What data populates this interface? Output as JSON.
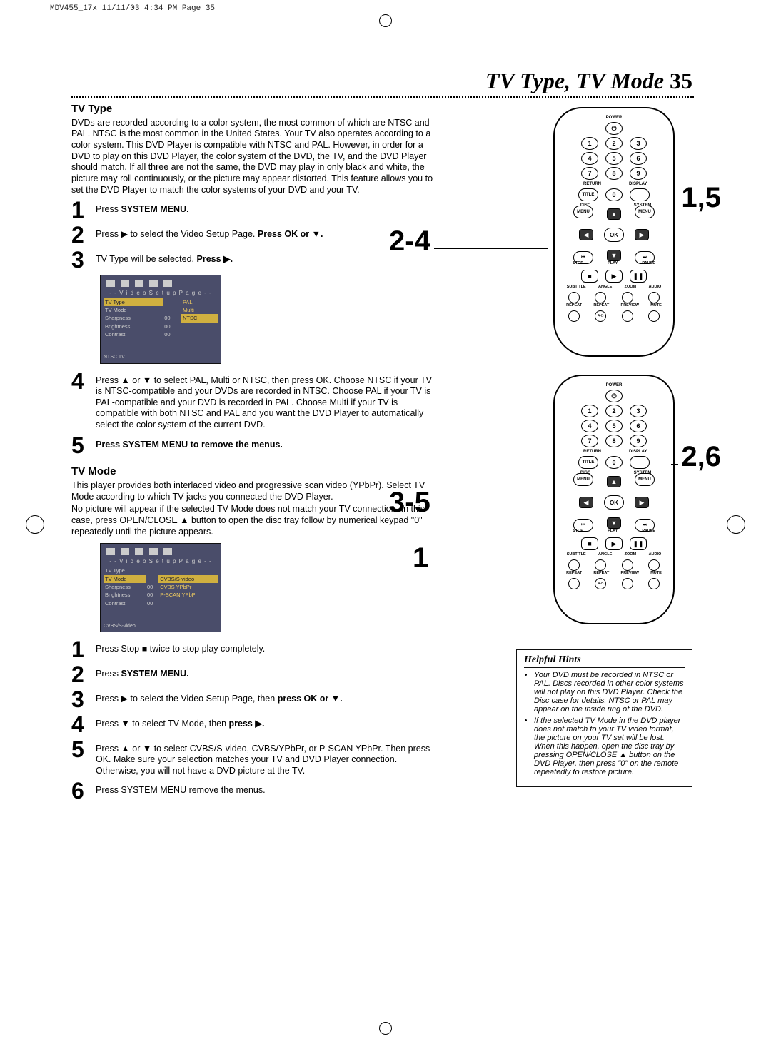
{
  "print_header": "MDV455_17x  11/11/03  4:34 PM  Page 35",
  "page_title": "TV Type, TV Mode",
  "page_number": "35",
  "tv_type": {
    "heading": "TV Type",
    "intro": "DVDs are recorded according to a color system, the most common of which are NTSC and PAL. NTSC is the most common in the United States. Your TV also operates according to a color system. This DVD Player is compatible with NTSC and PAL. However, in order for a DVD to play on this DVD Player, the color system of the DVD, the TV, and the DVD Player should match. If all three are not the same, the DVD may play in only black and white, the picture may roll continuously,  or the picture may appear distorted. This feature allows you to set the DVD Player to match the color systems of your DVD and your TV.",
    "step1_a": "Press ",
    "step1_b": "SYSTEM MENU.",
    "step2_a": "Press ▶ to select the Video Setup Page.  ",
    "step2_b": "Press OK or ▼.",
    "step3_a": "TV Type will be selected. ",
    "step3_b": "Press ▶.",
    "step4": "Press ▲ or ▼ to select PAL, Multi or NTSC, then press OK. Choose NTSC if your TV is NTSC-compatible and your DVDs are recorded in NTSC. Choose PAL if your TV is PAL-compatible and your DVD is recorded in PAL. Choose Multi if your TV is compatible with both NTSC and PAL and you want the DVD Player to automatically select the color system of the current DVD.",
    "step5": "Press SYSTEM MENU to remove the menus."
  },
  "tv_mode": {
    "heading": "TV Mode",
    "intro_a": "This player provides both interlaced video and progressive scan video (YPbPr). Select TV Mode according to which TV jacks you connected the DVD Player.",
    "intro_b": "No picture will appear if the selected TV Mode does not match your TV connection. In this case, press OPEN/CLOSE ▲  button to open the disc tray follow by numerical keypad \"0\" repeatedly until the picture appears.",
    "step1": "Press Stop ■ twice to stop play completely.",
    "step2_a": "Press ",
    "step2_b": "SYSTEM MENU.",
    "step3_a": "Press ▶ to select the Video Setup Page, then ",
    "step3_b": "press OK or ▼.",
    "step4_a": "Press ▼ to select TV Mode, then ",
    "step4_b": "press ▶.",
    "step5": "Press ▲ or ▼ to select CVBS/S-video, CVBS/YPbPr, or P-SCAN YPbPr. Then press OK. Make sure your selection matches your TV and DVD Player connection. Otherwise, you will not have a DVD picture at the TV.",
    "step6": "Press SYSTEM MENU remove the menus."
  },
  "onscreen1": {
    "title": "- -    V i d e o  S e t u p  P a g e    - -",
    "rows": [
      {
        "l": "TV Type",
        "r": "PAL",
        "hl": "l"
      },
      {
        "l": "TV Mode",
        "r": "Multi"
      },
      {
        "l": "Sharpness",
        "m": "00",
        "r": "NTSC",
        "hl": "r"
      },
      {
        "l": "Brightness",
        "m": "00"
      },
      {
        "l": "Contrast",
        "m": "00"
      }
    ],
    "footer": "NTSC TV"
  },
  "onscreen2": {
    "title": "- -    V i d e o  S e t u p  P a g e    - -",
    "rows": [
      {
        "l": "TV Type"
      },
      {
        "l": "TV Mode",
        "r": "CVBS/S-video",
        "hl": "both"
      },
      {
        "l": "Sharpness",
        "m": "00",
        "r": "CVBS YPbPr"
      },
      {
        "l": "Brightness",
        "m": "00",
        "r": "P-SCAN YPbPr"
      },
      {
        "l": "Contrast",
        "m": "00"
      }
    ],
    "footer": "CVBS/S-video"
  },
  "remote": {
    "power": "POWER",
    "nums": [
      "1",
      "2",
      "3",
      "4",
      "5",
      "6",
      "7",
      "8",
      "9",
      "0"
    ],
    "return": "RETURN",
    "display": "DISPLAY",
    "title": "TITLE",
    "disc": "DISC",
    "system": "SYSTEM",
    "menu": "MENU",
    "menu2": "MENU",
    "ok": "OK",
    "stop": "STOP",
    "play": "PLAY",
    "pause": "PAUSE",
    "row1_lbls": [
      "SUBTITLE",
      "ANGLE",
      "ZOOM",
      "AUDIO"
    ],
    "row2_lbls": [
      "REPEAT",
      "REPEAT",
      "PREVIEW",
      "MUTE"
    ],
    "ab": "A-B"
  },
  "indicators": {
    "a1": "1,5",
    "a2": "2-4",
    "b1": "2,6",
    "b2": "3-5",
    "b3": "1"
  },
  "hints": {
    "title": "Helpful Hints",
    "items": [
      "Your DVD must be recorded in NTSC or PAL. Discs recorded in other color systems will not play on this DVD Player. Check the Disc case for details. NTSC or PAL may appear on the inside ring of the DVD.",
      "If the selected TV Mode in the DVD player does not match to your TV video   format, the picture on your TV set will be lost. When this happen, open the disc tray by pressing OPEN/CLOSE ▲  button on the DVD Player, then press \"0\" on the remote repeatedly to restore picture."
    ]
  }
}
